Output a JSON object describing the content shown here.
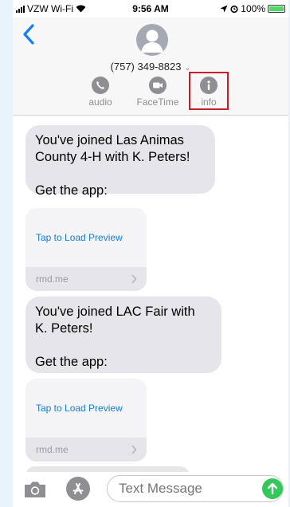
{
  "status_bar": {
    "carrier": "VZW Wi-Fi",
    "time": "9:56 AM",
    "battery": "100%",
    "battery_level": 1.0
  },
  "header": {
    "contact": "(757) 349-8823",
    "contact_chevron": "⌄",
    "actions": [
      {
        "label": "audio",
        "icon": "phone-icon"
      },
      {
        "label": "FaceTime",
        "icon": "video-camera-icon"
      },
      {
        "label": "info",
        "icon": "info-icon"
      }
    ],
    "highlight_color": "#c8202b"
  },
  "messages": [
    {
      "type": "text",
      "text": "You've joined Las Animas\nCounty 4-H with K. Peters!\n\nGet the app:"
    },
    {
      "type": "link",
      "preview_text": "Tap to Load Preview",
      "domain": "rmd.me"
    },
    {
      "type": "text",
      "text": "You've joined LAC Fair with\nK. Peters!\n\nGet the app:"
    },
    {
      "type": "link",
      "preview_text": "Tap to Load Preview",
      "domain": "rmd.me"
    }
  ],
  "input": {
    "placeholder": "Text Message"
  },
  "colors": {
    "accent_blue": "#1a7ccf",
    "bubble_gray": "#e5e5ea",
    "send_green": "#34c759"
  }
}
